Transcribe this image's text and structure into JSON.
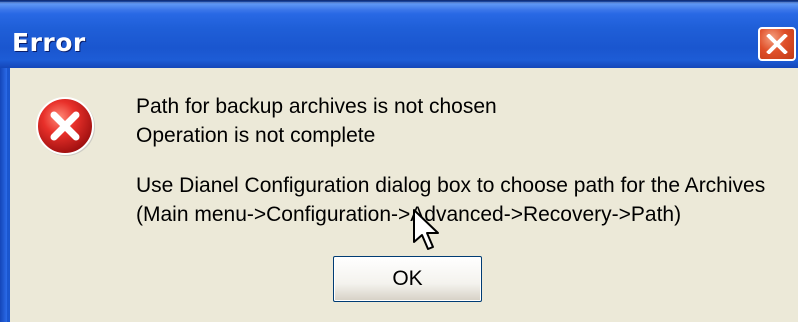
{
  "dialog": {
    "title": "Error",
    "message_lines": [
      "Path for backup archives is not chosen",
      "Operation is not complete",
      "Use Dianel Configuration dialog box to choose path for the Archives",
      "(Main menu->Configuration->Advanced->Recovery->Path)"
    ],
    "ok_label": "OK",
    "icon": "error-icon"
  },
  "titlebar": {
    "close_icon": "close-icon"
  },
  "colors": {
    "titlebar_blue": "#1f5fd8",
    "dialog_background": "#ece9d8",
    "close_button_red": "#e0502a",
    "error_icon_red": "#d8201a"
  }
}
